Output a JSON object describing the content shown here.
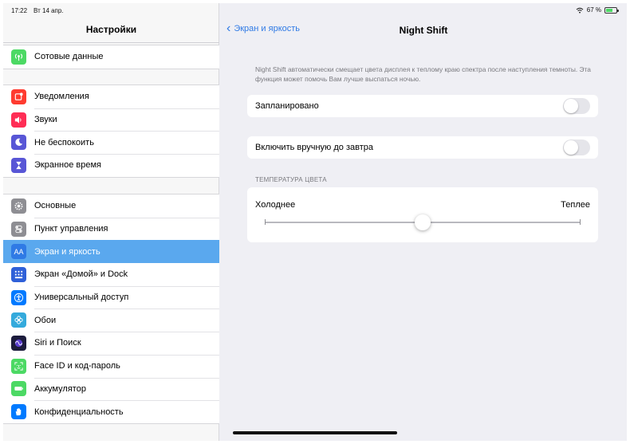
{
  "status": {
    "time": "17:22",
    "date": "Вт 14 апр.",
    "battery": "67 %",
    "battery_level": 0.67
  },
  "sidebar": {
    "title": "Настройки",
    "groups": [
      {
        "items": [
          {
            "label": "Сотовые данные",
            "icon": "antenna-icon",
            "color": "#4cd964"
          }
        ]
      },
      {
        "items": [
          {
            "label": "Уведомления",
            "icon": "notifications-icon",
            "color": "#ff3b30"
          },
          {
            "label": "Звуки",
            "icon": "speaker-icon",
            "color": "#ff2d55"
          },
          {
            "label": "Не беспокоить",
            "icon": "moon-icon",
            "color": "#5856d6"
          },
          {
            "label": "Экранное время",
            "icon": "hourglass-icon",
            "color": "#5856d6"
          }
        ]
      },
      {
        "items": [
          {
            "label": "Основные",
            "icon": "gear-icon",
            "color": "#8e8e93"
          },
          {
            "label": "Пункт управления",
            "icon": "toggles-icon",
            "color": "#8e8e93"
          },
          {
            "label": "Экран и яркость",
            "icon": "text-size-icon",
            "color": "#007aff",
            "selected": true
          },
          {
            "label": "Экран «Домой» и Dock",
            "icon": "grid-icon",
            "color": "#007aff"
          },
          {
            "label": "Универсальный доступ",
            "icon": "accessibility-icon",
            "color": "#007aff"
          },
          {
            "label": "Обои",
            "icon": "flower-icon",
            "color": "#34aadc"
          },
          {
            "label": "Siri и Поиск",
            "icon": "siri-icon",
            "color": "#1c1c3c"
          },
          {
            "label": "Face ID и код-пароль",
            "icon": "face-id-icon",
            "color": "#4cd964"
          },
          {
            "label": "Аккумулятор",
            "icon": "battery-icon",
            "color": "#4cd964"
          },
          {
            "label": "Конфиденциальность",
            "icon": "hand-icon",
            "color": "#007aff"
          }
        ]
      }
    ]
  },
  "detail": {
    "back_label": "Экран и яркость",
    "title": "Night Shift",
    "description": "Night Shift автоматически смещает цвета дисплея к теплому краю спектра после наступления темноты. Эта функция может помочь Вам лучше выспаться ночью.",
    "scheduled_label": "Запланировано",
    "scheduled_on": false,
    "manual_label": "Включить вручную до завтра",
    "manual_on": false,
    "temperature_section": "ТЕМПЕРАТУРА ЦВЕТА",
    "cooler_label": "Холоднее",
    "warmer_label": "Теплее",
    "temperature_value": 0.5
  }
}
